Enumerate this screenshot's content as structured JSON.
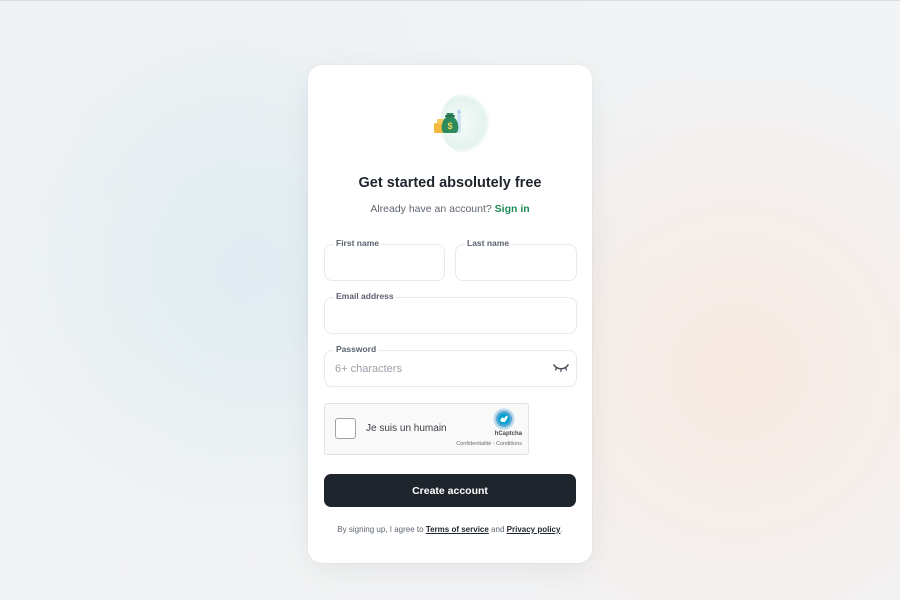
{
  "card": {
    "logo_icon": "money-bag-icon",
    "title": "Get started absolutely free",
    "subtitle_prefix": "Already have an account?",
    "signin_link": "Sign in"
  },
  "form": {
    "first_name": {
      "label": "First name",
      "value": "",
      "placeholder": ""
    },
    "last_name": {
      "label": "Last name",
      "value": "",
      "placeholder": ""
    },
    "email": {
      "label": "Email address",
      "value": "",
      "placeholder": ""
    },
    "password": {
      "label": "Password",
      "value": "",
      "placeholder": "6+ characters",
      "toggle_icon": "eye-closed-icon"
    }
  },
  "captcha": {
    "label": "Je suis un humain",
    "brand": "hCaptcha",
    "links": "Confidentialité - Conditions",
    "checked": false
  },
  "submit": {
    "label": "Create account"
  },
  "terms": {
    "prefix": "By signing up, I agree to",
    "tos": "Terms of service",
    "and": "and",
    "privacy": "Privacy policy",
    "suffix": "."
  },
  "colors": {
    "accent_green": "#208a56",
    "button_dark": "#1f252c",
    "captcha_blue": "#0074bf"
  }
}
